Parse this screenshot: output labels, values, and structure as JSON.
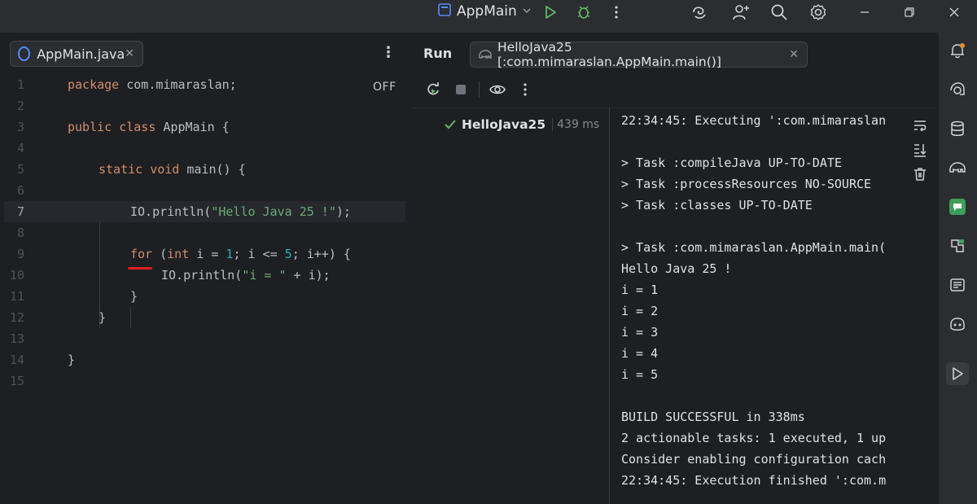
{
  "titlebar": {
    "run_config_label": "AppMain",
    "icons": [
      "app-icon",
      "run-icon",
      "debug-icon",
      "more-vertical-icon",
      "ai-swirl-icon",
      "add-user-icon",
      "search-icon",
      "settings-icon",
      "minimize-icon",
      "restore-icon",
      "close-icon"
    ]
  },
  "editor": {
    "tab_label": "AppMain.java",
    "off_label": "OFF",
    "line_numbers": [
      "1",
      "2",
      "3",
      "4",
      "5",
      "6",
      "7",
      "8",
      "9",
      "10",
      "11",
      "12",
      "13",
      "14",
      "15"
    ],
    "current_line": 7,
    "code": {
      "l1_kw": "package",
      "l1_rest": " com.mimaraslan;",
      "l3_kw1": "public",
      "l3_kw2": "class",
      "l3_rest": " AppMain {",
      "l5_kw1": "static",
      "l5_kw2": "void",
      "l5_rest": " main() {",
      "l7_pre": "IO.println(",
      "l7_str": "\"Hello Java 25 !\"",
      "l7_post": ");",
      "l9_kw1": "for",
      "l9_a": " (",
      "l9_kw2": "int",
      "l9_b": " i = ",
      "l9_n1": "1",
      "l9_c": "; i <= ",
      "l9_n2": "5",
      "l9_d": "; i++) {",
      "l10_pre": "IO.println(",
      "l10_str": "\"i = \"",
      "l10_post": " + i);",
      "l11": "}",
      "l12": "}",
      "l14": "}"
    }
  },
  "run": {
    "title": "Run",
    "tab_label": "HelloJava25 [:com.mimaraslan.AppMain.main()]",
    "tree_item": {
      "label": "HelloJava25",
      "time": "439 ms"
    },
    "console_lines": [
      "22:34:45: Executing ':com.mimaraslan",
      "",
      "> Task :compileJava UP-TO-DATE",
      "> Task :processResources NO-SOURCE",
      "> Task :classes UP-TO-DATE",
      "",
      "> Task :com.mimaraslan.AppMain.main(",
      "Hello Java 25 !",
      "i = 1",
      "i = 2",
      "i = 3",
      "i = 4",
      "i = 5",
      "",
      "BUILD SUCCESSFUL in 338ms",
      "2 actionable tasks: 1 executed, 1 up",
      "Consider enabling configuration cach",
      "22:34:45: Execution finished ':com.m"
    ]
  },
  "colors": {
    "background": "#1e1f22",
    "panel": "#2b2d30",
    "keyword": "#cf8e6d",
    "string": "#6aab73",
    "number": "#2aacb8",
    "success": "#5fb865",
    "run_green": "#5fb865",
    "error_underline": "#e02020"
  }
}
